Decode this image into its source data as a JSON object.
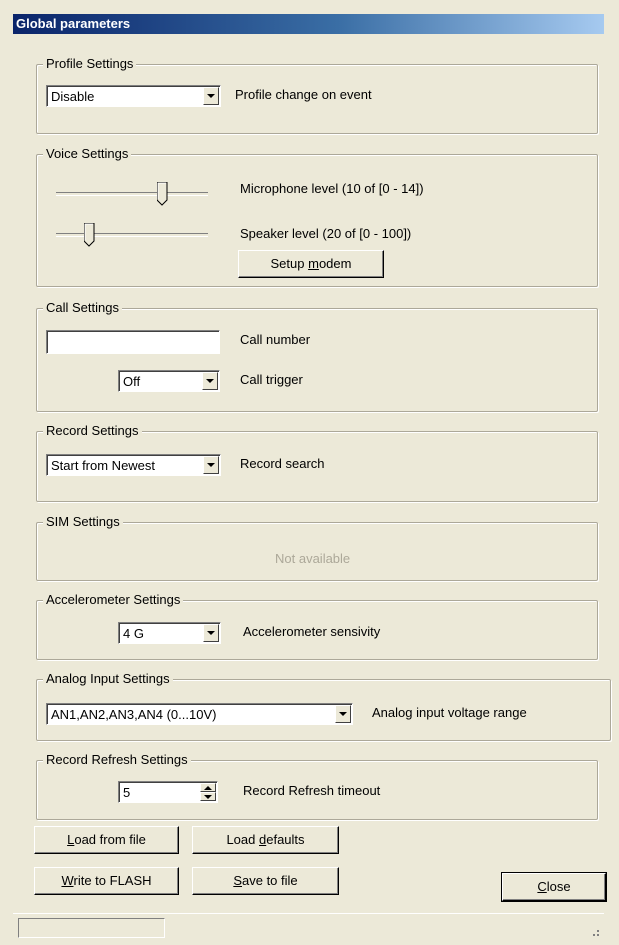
{
  "window": {
    "title": "Global parameters"
  },
  "profile": {
    "legend": "Profile Settings",
    "select_value": "Disable",
    "label": "Profile change on event"
  },
  "voice": {
    "legend": "Voice Settings",
    "microphone_label": "Microphone level (10 of [0 - 14])",
    "microphone_value": 10,
    "microphone_max": 14,
    "speaker_label": "Speaker level (20 of [0 - 100])",
    "speaker_value": 20,
    "speaker_max": 100,
    "setup_button_prefix": "Setup ",
    "setup_button_mnemonic": "m",
    "setup_button_suffix": "odem"
  },
  "call": {
    "legend": "Call Settings",
    "number_value": "",
    "number_label": "Call number",
    "trigger_value": "Off",
    "trigger_label": "Call trigger"
  },
  "record": {
    "legend": "Record Settings",
    "search_value": "Start from Newest",
    "search_label": "Record search"
  },
  "sim": {
    "legend": "SIM Settings",
    "status": "Not available"
  },
  "accelerometer": {
    "legend": "Accelerometer Settings",
    "value": "4 G",
    "label": "Accelerometer sensivity"
  },
  "analog": {
    "legend": "Analog Input Settings",
    "value": "AN1,AN2,AN3,AN4 (0...10V)",
    "label": "Analog input voltage range"
  },
  "refresh": {
    "legend": "Record Refresh Settings",
    "value": "5",
    "label": "Record Refresh timeout"
  },
  "buttons": {
    "load_file_mn": "L",
    "load_file_rest": "oad from file",
    "load_defaults_pre": "Load ",
    "load_defaults_mn": "d",
    "load_defaults_rest": "efaults",
    "write_flash_mn": "W",
    "write_flash_rest": "rite to FLASH",
    "save_file_mn": "S",
    "save_file_rest": "ave to file",
    "close_mn": "C",
    "close_rest": "lose"
  },
  "status_bar": {
    "text": ""
  },
  "colors": {
    "title_start": "#0a246a",
    "title_end": "#a6caf0",
    "face": "#ece9d8",
    "disabled_text": "#aca899"
  }
}
